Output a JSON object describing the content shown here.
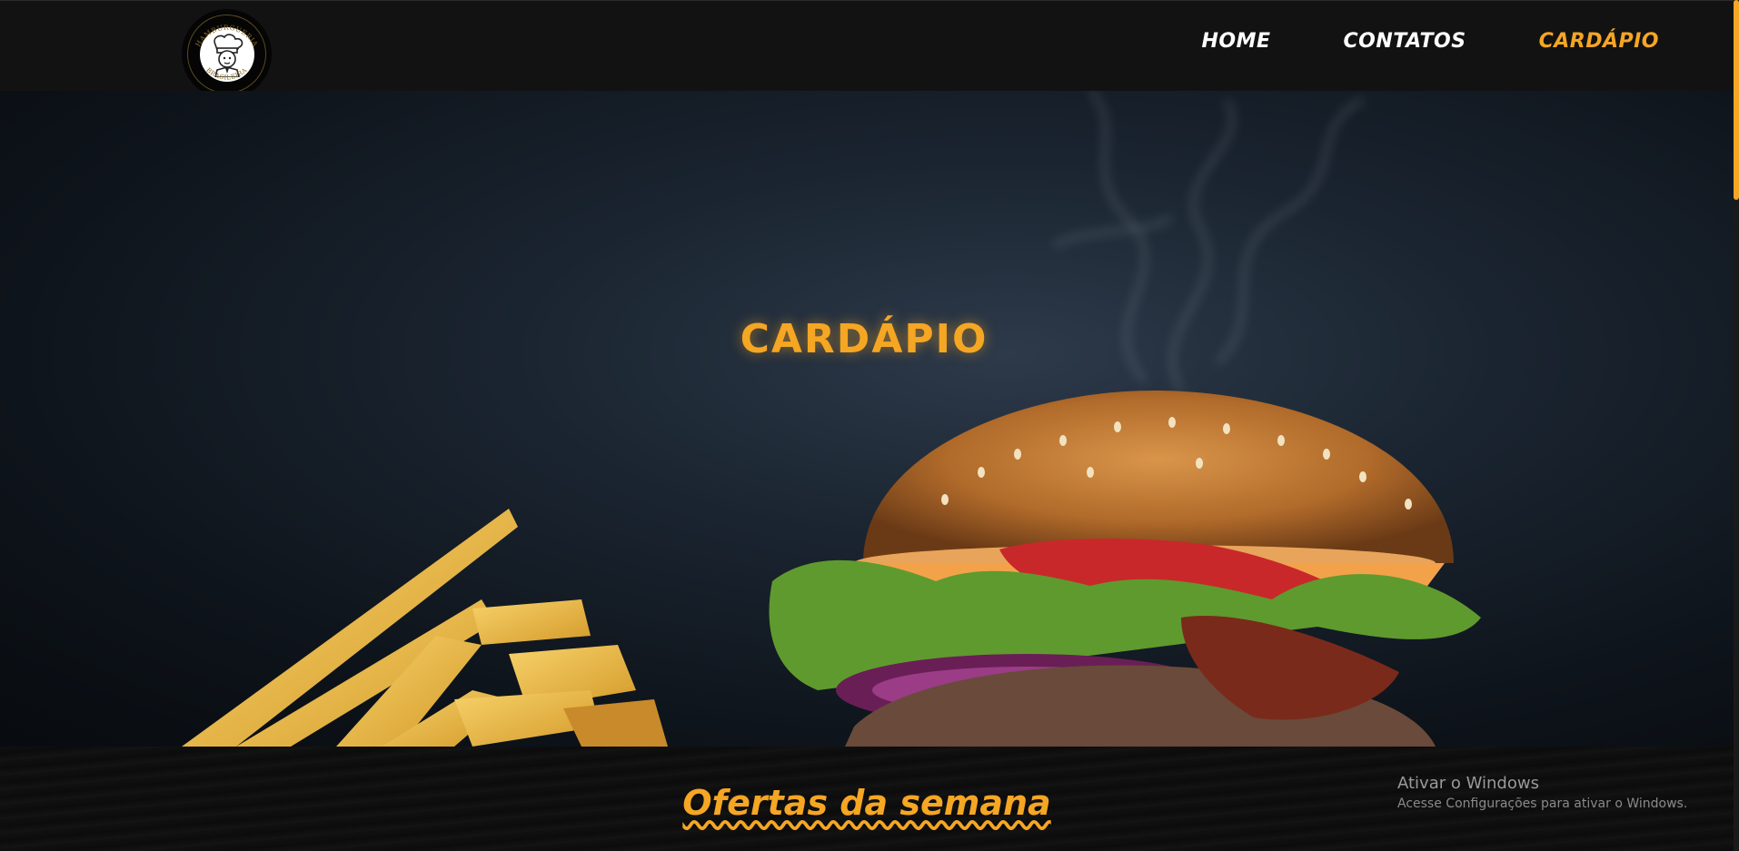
{
  "header": {
    "logo_text_top": "HAMBURGUERIA",
    "logo_text_bottom": "BRASILEIRA",
    "nav": [
      {
        "label": "HOME",
        "active": false
      },
      {
        "label": "CONTATOS",
        "active": false
      },
      {
        "label": "CARDÁPIO",
        "active": true
      }
    ]
  },
  "hero": {
    "title": "CARDÁPIO"
  },
  "offers": {
    "title": "Ofertas da semana"
  },
  "watermark": {
    "title": "Ativar o Windows",
    "subtitle": "Acesse Configurações para ativar o Windows."
  },
  "colors": {
    "accent": "#f5a623",
    "header_bg": "#131213",
    "nav_text": "#ffffff"
  },
  "icons": [
    "chef-logo-icon"
  ]
}
